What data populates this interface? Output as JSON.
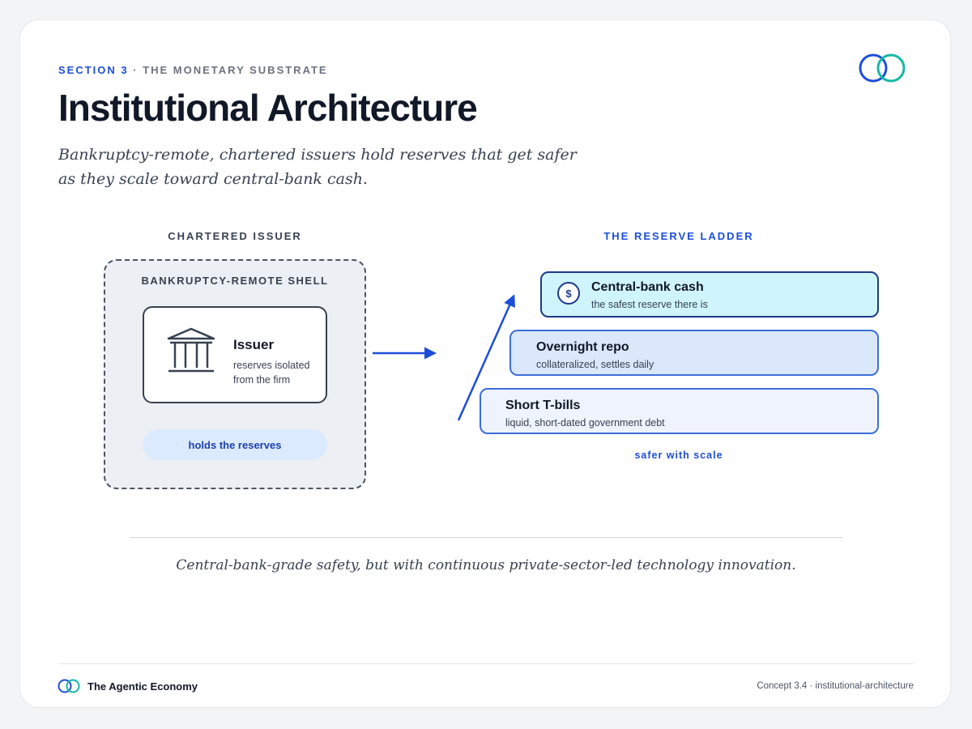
{
  "header": {
    "section": "SECTION 3",
    "separator": " · ",
    "section_topic": "THE MONETARY SUBSTRATE",
    "title": "Institutional Architecture",
    "subtitle": "Bankruptcy-remote, chartered issuers hold reserves that get safer as they scale toward central-bank cash."
  },
  "left_panel": {
    "heading": "CHARTERED ISSUER",
    "shell_label": "BANKRUPTCY-REMOTE SHELL",
    "issuer_title": "Issuer",
    "issuer_desc": "reserves isolated from the firm",
    "issuer_icon": "bank-building-icon",
    "holds_label": "holds the reserves"
  },
  "right_panel": {
    "heading": "THE RESERVE LADDER",
    "rungs": [
      {
        "title": "Central-bank cash",
        "desc": "the safest reserve there is",
        "icon": "$"
      },
      {
        "title": "Overnight repo",
        "desc": "collateralized, settles daily"
      },
      {
        "title": "Short T-bills",
        "desc": "liquid, short-dated government debt"
      }
    ],
    "scale_note": "safer with scale"
  },
  "takeaway": "Central-bank-grade safety, but with continuous private-sector-led technology innovation.",
  "footer": {
    "brand": "The Agentic Economy",
    "concept": "Concept 3.4 · institutional-architecture"
  },
  "colors": {
    "accent_blue": "#1d4ed8",
    "logo_blue": "#1d4ed8",
    "logo_teal": "#14b8a6",
    "top_rung_fill": "#cff4fb"
  }
}
